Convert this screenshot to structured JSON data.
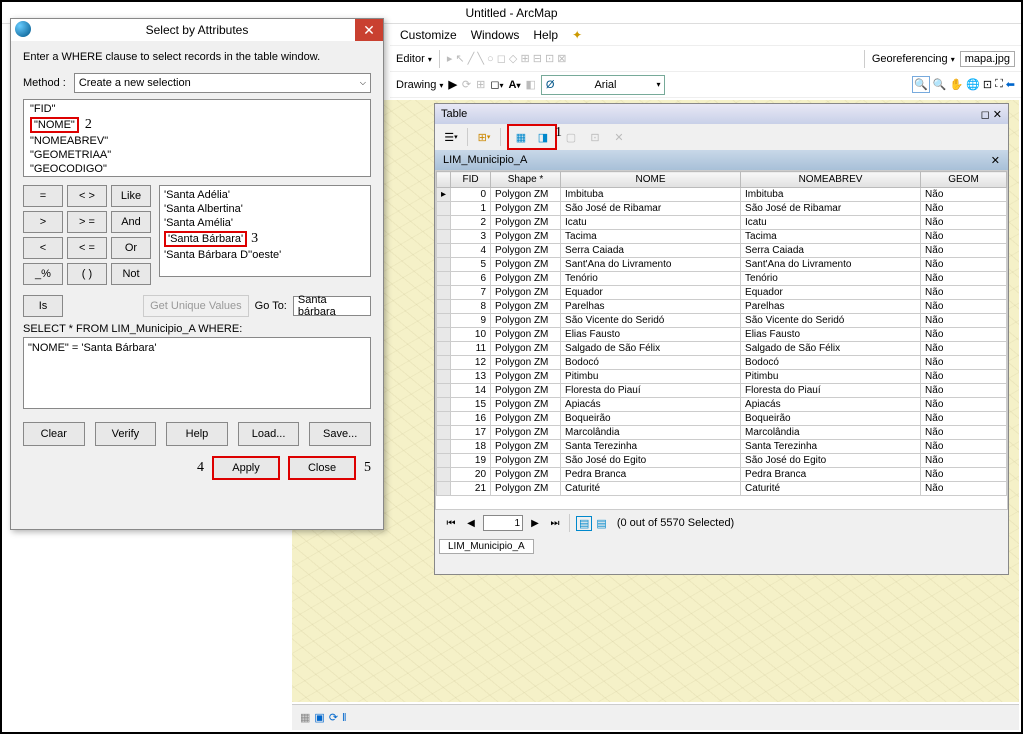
{
  "main": {
    "title": "Untitled - ArcMap",
    "menubar": [
      "Customize",
      "Windows",
      "Help"
    ],
    "editor_label": "Editor",
    "drawing_label": "Drawing",
    "font_name": "Arial",
    "geo_label": "Georeferencing",
    "geo_file": "mapa.jpg"
  },
  "dialog": {
    "title": "Select by Attributes",
    "instruction": "Enter a WHERE clause to select records in the table window.",
    "method_label": "Method :",
    "method_value": "Create a new selection",
    "fields": [
      "\"FID\"",
      "\"NOME\"",
      "\"NOMEABREV\"",
      "\"GEOMETRIAA\"",
      "\"GEOCODIGO\""
    ],
    "ops": {
      "eq": "=",
      "neq": "< >",
      "like": "Like",
      "gt": ">",
      "gte": "> =",
      "and": "And",
      "lt": "<",
      "lte": "< =",
      "or": "Or",
      "pct": "_%",
      "paren": "( )",
      "not": "Not",
      "is": "Is"
    },
    "values": [
      "'Santa Adélia'",
      "'Santa Albertina'",
      "'Santa Amélia'",
      "'Santa Bárbara'",
      "'Santa Bárbara D''oeste'"
    ],
    "unique_btn": "Get Unique Values",
    "goto_label": "Go To:",
    "goto_value": "Santa bárbara",
    "select_label": "SELECT * FROM LIM_Municipio_A WHERE:",
    "where_text": "\"NOME\" = 'Santa Bárbara'",
    "buttons": {
      "clear": "Clear",
      "verify": "Verify",
      "help": "Help",
      "load": "Load...",
      "save": "Save...",
      "apply": "Apply",
      "close": "Close"
    },
    "annotations": {
      "a1": "1",
      "a2": "2",
      "a3": "3",
      "a4": "4",
      "a5": "5"
    }
  },
  "table": {
    "title": "Table",
    "layer": "LIM_Municipio_A",
    "columns": [
      "",
      "FID",
      "Shape *",
      "NOME",
      "NOMEABREV",
      "GEOM"
    ],
    "rows": [
      {
        "fid": 0,
        "shape": "Polygon ZM",
        "nome": "Imbituba",
        "abrev": "Imbituba",
        "geom": "Não"
      },
      {
        "fid": 1,
        "shape": "Polygon ZM",
        "nome": "São José de Ribamar",
        "abrev": "São José de Ribamar",
        "geom": "Não"
      },
      {
        "fid": 2,
        "shape": "Polygon ZM",
        "nome": "Icatu",
        "abrev": "Icatu",
        "geom": "Não"
      },
      {
        "fid": 3,
        "shape": "Polygon ZM",
        "nome": "Tacima",
        "abrev": "Tacima",
        "geom": "Não"
      },
      {
        "fid": 4,
        "shape": "Polygon ZM",
        "nome": "Serra Caiada",
        "abrev": "Serra Caiada",
        "geom": "Não"
      },
      {
        "fid": 5,
        "shape": "Polygon ZM",
        "nome": "Sant'Ana do Livramento",
        "abrev": "Sant'Ana do Livramento",
        "geom": "Não"
      },
      {
        "fid": 6,
        "shape": "Polygon ZM",
        "nome": "Tenório",
        "abrev": "Tenório",
        "geom": "Não"
      },
      {
        "fid": 7,
        "shape": "Polygon ZM",
        "nome": "Equador",
        "abrev": "Equador",
        "geom": "Não"
      },
      {
        "fid": 8,
        "shape": "Polygon ZM",
        "nome": "Parelhas",
        "abrev": "Parelhas",
        "geom": "Não"
      },
      {
        "fid": 9,
        "shape": "Polygon ZM",
        "nome": "São Vicente do Seridó",
        "abrev": "São Vicente do Seridó",
        "geom": "Não"
      },
      {
        "fid": 10,
        "shape": "Polygon ZM",
        "nome": "Elias Fausto",
        "abrev": "Elias Fausto",
        "geom": "Não"
      },
      {
        "fid": 11,
        "shape": "Polygon ZM",
        "nome": "Salgado de São Félix",
        "abrev": "Salgado de São Félix",
        "geom": "Não"
      },
      {
        "fid": 12,
        "shape": "Polygon ZM",
        "nome": "Bodocó",
        "abrev": "Bodocó",
        "geom": "Não"
      },
      {
        "fid": 13,
        "shape": "Polygon ZM",
        "nome": "Pitimbu",
        "abrev": "Pitimbu",
        "geom": "Não"
      },
      {
        "fid": 14,
        "shape": "Polygon ZM",
        "nome": "Floresta do Piauí",
        "abrev": "Floresta do Piauí",
        "geom": "Não"
      },
      {
        "fid": 15,
        "shape": "Polygon ZM",
        "nome": "Apiacás",
        "abrev": "Apiacás",
        "geom": "Não"
      },
      {
        "fid": 16,
        "shape": "Polygon ZM",
        "nome": "Boqueirão",
        "abrev": "Boqueirão",
        "geom": "Não"
      },
      {
        "fid": 17,
        "shape": "Polygon ZM",
        "nome": "Marcolândia",
        "abrev": "Marcolândia",
        "geom": "Não"
      },
      {
        "fid": 18,
        "shape": "Polygon ZM",
        "nome": "Santa Terezinha",
        "abrev": "Santa Terezinha",
        "geom": "Não"
      },
      {
        "fid": 19,
        "shape": "Polygon ZM",
        "nome": "São José do Egito",
        "abrev": "São José do Egito",
        "geom": "Não"
      },
      {
        "fid": 20,
        "shape": "Polygon ZM",
        "nome": "Pedra Branca",
        "abrev": "Pedra Branca",
        "geom": "Não"
      },
      {
        "fid": 21,
        "shape": "Polygon ZM",
        "nome": "Caturité",
        "abrev": "Caturité",
        "geom": "Não"
      }
    ],
    "nav_page": "1",
    "nav_status": "(0 out of 5570 Selected)",
    "tab_label": "LIM_Municipio_A"
  }
}
